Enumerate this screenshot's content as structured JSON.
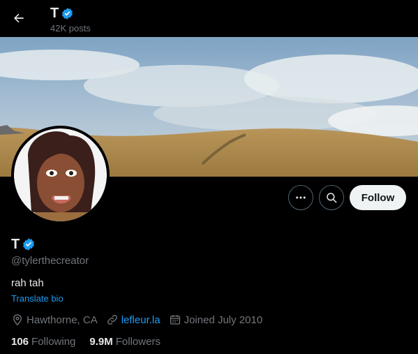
{
  "header": {
    "title": "T",
    "posts_count": "42K posts"
  },
  "profile": {
    "name": "T",
    "handle": "@tylerthecreator",
    "bio": "rah tah",
    "translate_label": "Translate bio",
    "location": "Hawthorne, CA",
    "website": "lefleur.la",
    "joined": "Joined July 2010",
    "following_count": "106",
    "following_label": "Following",
    "followers_count": "9.9M",
    "followers_label": "Followers"
  },
  "actions": {
    "follow_label": "Follow"
  },
  "icons": {
    "back": "arrow-left-icon",
    "verified": "verified-badge-icon",
    "more": "more-icon",
    "search": "search-icon",
    "location": "location-pin-icon",
    "link": "link-icon",
    "calendar": "calendar-icon"
  },
  "colors": {
    "accent": "#1d9bf0",
    "background": "#000000",
    "text_primary": "#e7e9ea",
    "text_secondary": "#71767b"
  }
}
